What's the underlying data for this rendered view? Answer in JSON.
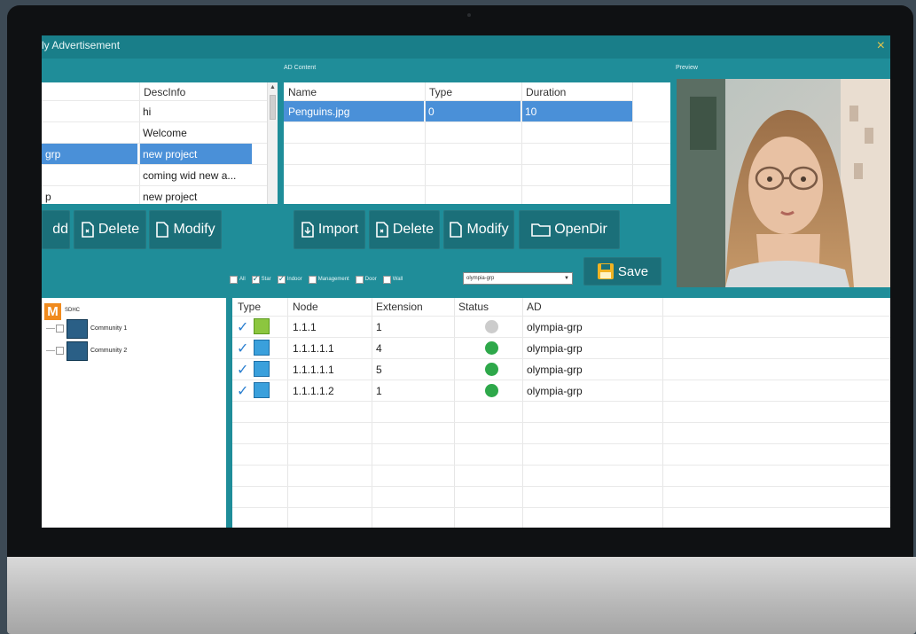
{
  "window": {
    "title": "ly Advertisement",
    "close_label": "×"
  },
  "sections": {
    "ad_content": "AD Content",
    "preview": "Preview"
  },
  "projects": {
    "header": "DescInfo",
    "rows": [
      {
        "name": "",
        "desc": "hi"
      },
      {
        "name": "",
        "desc": "Welcome"
      },
      {
        "name": "grp",
        "desc": "new project",
        "selected": true
      },
      {
        "name": "",
        "desc": "coming wid new a..."
      },
      {
        "name": "p",
        "desc": "new project"
      }
    ]
  },
  "project_buttons": {
    "add": "dd",
    "delete": "Delete",
    "modify": "Modify"
  },
  "ad_content": {
    "headers": {
      "name": "Name",
      "type": "Type",
      "duration": "Duration"
    },
    "rows": [
      {
        "name": "Penguins.jpg",
        "type": "0",
        "duration": "10",
        "selected": true
      }
    ]
  },
  "content_buttons": {
    "import": "Import",
    "delete": "Delete",
    "modify": "Modify",
    "opendir": "OpenDir"
  },
  "filters": [
    {
      "label": "All",
      "checked": false
    },
    {
      "label": "Star",
      "checked": true
    },
    {
      "label": "Indoor",
      "checked": true
    },
    {
      "label": "Management",
      "checked": false
    },
    {
      "label": "Door",
      "checked": false
    },
    {
      "label": "Wall",
      "checked": false
    }
  ],
  "group_select": {
    "value": "olympia-grp"
  },
  "save_button": {
    "label": "Save"
  },
  "tree": {
    "root": {
      "badge": "M",
      "label": "SDHC"
    },
    "children": [
      {
        "label": "Community 1"
      },
      {
        "label": "Community 2"
      }
    ]
  },
  "devices": {
    "headers": {
      "type": "Type",
      "node": "Node",
      "extension": "Extension",
      "status": "Status",
      "ad": "AD"
    },
    "rows": [
      {
        "node": "1.1.1",
        "extension": "1",
        "status": "offline",
        "ad": "olympia-grp",
        "icon": "door-station-icon"
      },
      {
        "node": "1.1.1.1.1",
        "extension": "4",
        "status": "online",
        "ad": "olympia-grp",
        "icon": "indoor-monitor-icon"
      },
      {
        "node": "1.1.1.1.1",
        "extension": "5",
        "status": "online",
        "ad": "olympia-grp",
        "icon": "indoor-monitor-icon"
      },
      {
        "node": "1.1.1.1.2",
        "extension": "1",
        "status": "online",
        "ad": "olympia-grp",
        "icon": "indoor-monitor-icon"
      }
    ]
  },
  "colors": {
    "window_bg": "#1f8d99",
    "button_bg": "#1b6f79",
    "selection": "#4a90d8",
    "status_online": "#2ea84a",
    "status_offline": "#cccccc",
    "save_icon": "#f0b323"
  }
}
